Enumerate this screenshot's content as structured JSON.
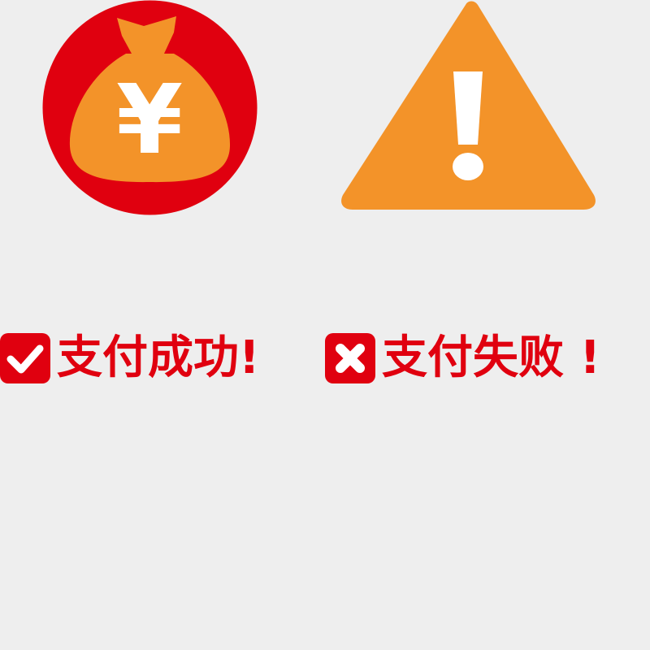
{
  "colors": {
    "background": "#eeeeee",
    "red": "#e0000f",
    "orange": "#f39329",
    "white": "#ffffff"
  },
  "icons": {
    "money_bag": "money-bag-yuan-icon",
    "warning": "warning-triangle-icon",
    "check": "check-square-icon",
    "cross": "cross-square-icon"
  },
  "money_bag_symbol": "¥",
  "status": {
    "success_label": "支付成功!",
    "failure_label": "支付失败 !"
  }
}
